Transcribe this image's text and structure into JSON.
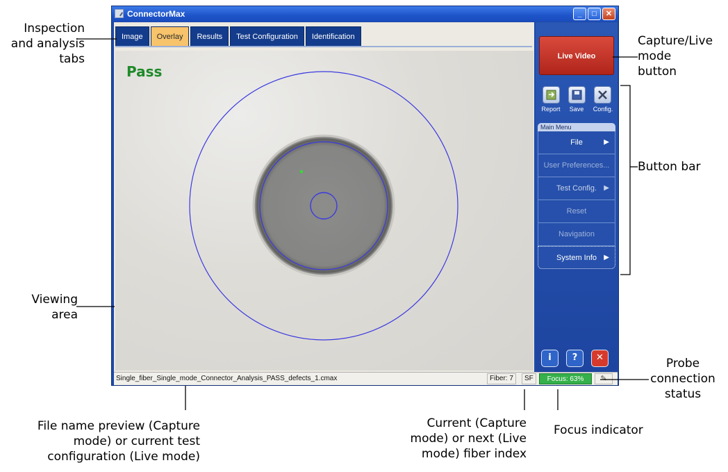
{
  "window": {
    "title": "ConnectorMax",
    "controls": [
      "_",
      "□",
      "✕"
    ]
  },
  "tabs": [
    {
      "label": "Image",
      "active": false
    },
    {
      "label": "Overlay",
      "active": true
    },
    {
      "label": "Results",
      "active": false
    },
    {
      "label": "Test Configuration",
      "active": false
    },
    {
      "label": "Identification",
      "active": false
    }
  ],
  "viewing": {
    "result_label": "Pass",
    "result_color": "#1f8a2a"
  },
  "right_panel": {
    "live_button": "Live Video",
    "tools": [
      {
        "label": "Report",
        "icon": "report-icon"
      },
      {
        "label": "Save",
        "icon": "save-icon"
      },
      {
        "label": "Config.",
        "icon": "config-icon"
      }
    ],
    "menu_title": "Main Menu",
    "menu_items": [
      {
        "label": "File",
        "arrow": "▶",
        "enabled": true
      },
      {
        "label": "User Preferences...",
        "arrow": "",
        "enabled": false
      },
      {
        "label": "Test Config.",
        "arrow": "▶",
        "enabled": false
      },
      {
        "label": "Reset",
        "arrow": "",
        "enabled": false
      },
      {
        "label": "Navigation",
        "arrow": "",
        "enabled": false
      },
      {
        "label": "System Info",
        "arrow": "▶",
        "enabled": true
      }
    ],
    "bottom_buttons": [
      {
        "icon": "info-icon",
        "glyph": "i"
      },
      {
        "icon": "help-icon",
        "glyph": "?"
      },
      {
        "icon": "exit-icon",
        "glyph": "✕"
      }
    ]
  },
  "statusbar": {
    "file_name": "Single_fiber_Single_mode_Connector_Analysis_PASS_defects_1.cmax",
    "fiber": "Fiber: 7",
    "fiber_mode": "SF",
    "focus": "Focus: 63%",
    "focus_color": "#35b04a",
    "probe_glyph": "✎"
  },
  "callouts": {
    "tabs": "Inspection\nand analysis\ntabs",
    "capture_live": "Capture/Live\nmode\nbutton",
    "button_bar": "Button bar",
    "viewing_area": "Viewing\narea",
    "probe": "Probe\nconnection\nstatus",
    "file_name": "File name preview (Capture\nmode) or current test\nconfiguration (Live mode)",
    "fiber_index": "Current (Capture\nmode) or next (Live\nmode) fiber index",
    "focus": "Focus indicator"
  }
}
